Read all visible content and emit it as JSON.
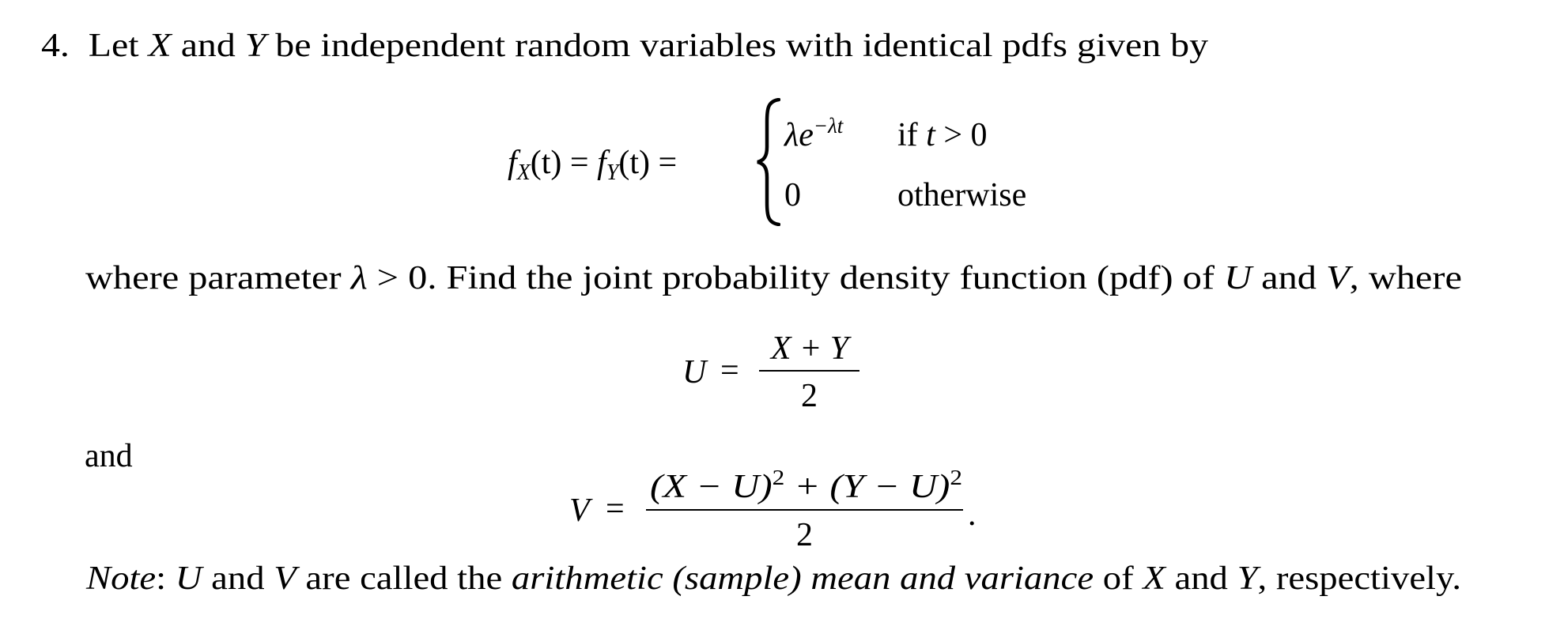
{
  "problem": {
    "number": "4.",
    "intro": {
      "t1": "Let ",
      "X": "X",
      "t2": " and ",
      "Y": "Y",
      "t3": " be independent random variables with identical pdfs given by"
    },
    "pdf": {
      "lhs_f1": "f",
      "lhs_sub1": "X",
      "lhs_arg1": "(t) = ",
      "lhs_f2": "f",
      "lhs_sub2": "Y",
      "lhs_arg2": "(t) =",
      "case1_lambda": "λe",
      "case1_exp": "−λt",
      "case1_cond_if": "if ",
      "case1_cond_t": "t",
      "case1_cond_rest": " > 0",
      "case2_value": "0",
      "case2_cond": "otherwise"
    },
    "where_line": {
      "t1": "where parameter ",
      "lambda": "λ",
      "t2": " > 0.  Find the joint probability density function (pdf) of ",
      "U": "U",
      "t3": " and ",
      "V": "V",
      "t4": ", where"
    },
    "u_formula": {
      "lhs": "U",
      "eq": "=",
      "numerator": "X + Y",
      "denominator": "2"
    },
    "and_word": "and",
    "v_formula": {
      "lhs": "V",
      "eq": "=",
      "numerator": "(X − U)",
      "num_sup1": "2",
      "num_mid": " + (Y − U)",
      "num_sup2": "2",
      "denominator": "2",
      "period": "."
    },
    "note": {
      "label": "Note",
      "colon": ": ",
      "U": "U",
      "t1": " and ",
      "V": "V",
      "t2": " are called the ",
      "emph": "arithmetic (sample) mean and variance",
      "t3": " of ",
      "X": "X",
      "t4": " and ",
      "Y": "Y",
      "t5": ", respectively."
    }
  }
}
